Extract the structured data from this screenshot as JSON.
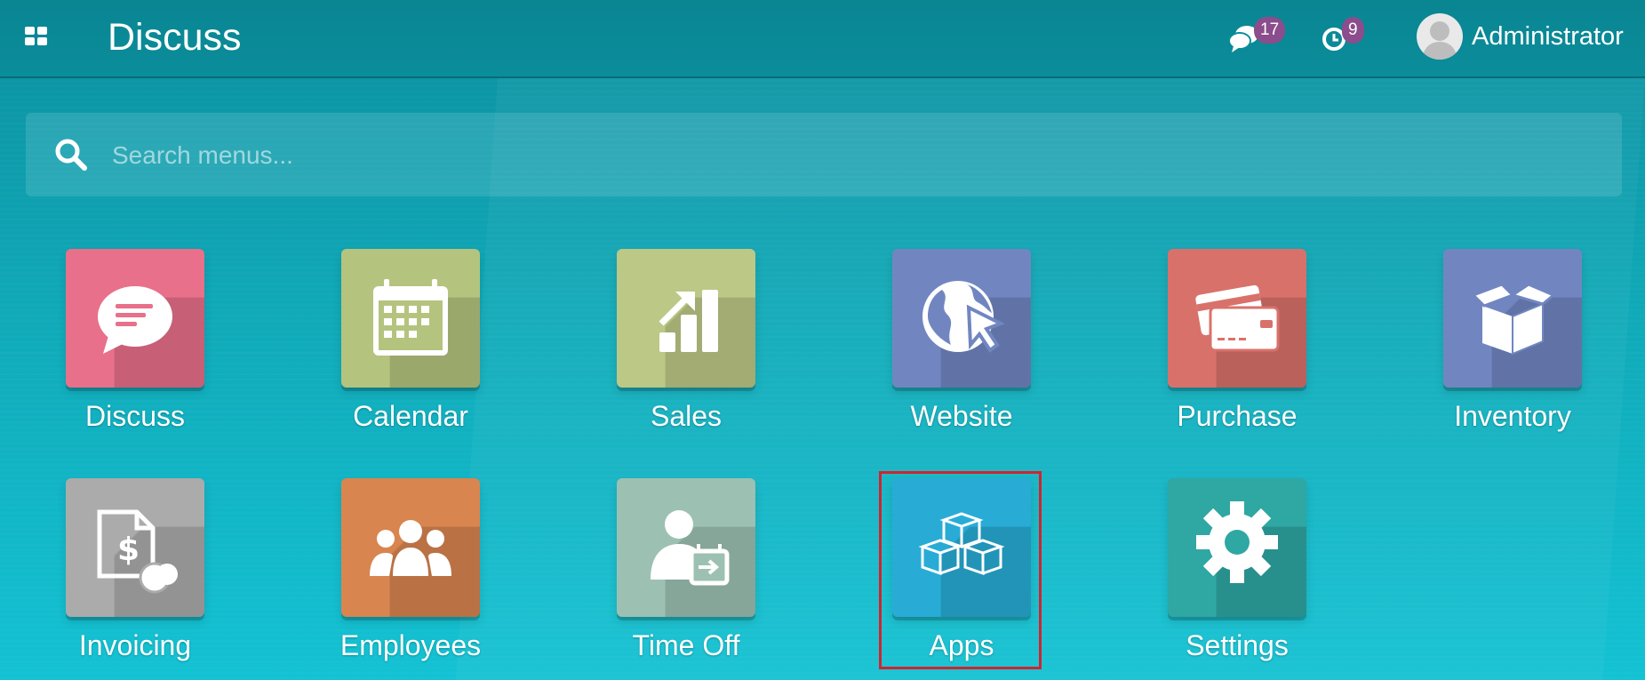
{
  "navbar": {
    "brand": "Discuss",
    "messages_count": "17",
    "activities_count": "9",
    "user_name": "Administrator"
  },
  "search": {
    "placeholder": "Search menus..."
  },
  "apps": [
    {
      "label": "Discuss",
      "icon": "chat-bubble-icon",
      "color": "#e8708a"
    },
    {
      "label": "Calendar",
      "icon": "calendar-icon",
      "color": "#b4c47e"
    },
    {
      "label": "Sales",
      "icon": "sales-chart-icon",
      "color": "#bcc886"
    },
    {
      "label": "Website",
      "icon": "globe-cursor-icon",
      "color": "#7186c1"
    },
    {
      "label": "Purchase",
      "icon": "credit-card-icon",
      "color": "#d9716b"
    },
    {
      "label": "Inventory",
      "icon": "open-box-icon",
      "color": "#7186c1"
    },
    {
      "label": "Invoicing",
      "icon": "invoice-dollar-icon",
      "color": "#ababab"
    },
    {
      "label": "Employees",
      "icon": "people-group-icon",
      "color": "#d88550"
    },
    {
      "label": "Time Off",
      "icon": "person-calendar-icon",
      "color": "#9cc1b2"
    },
    {
      "label": "Apps",
      "icon": "cubes-icon",
      "color": "#28acd6"
    },
    {
      "label": "Settings",
      "icon": "gear-icon",
      "color": "#2fa7a3"
    }
  ],
  "colors": {
    "badge": "#8b4d8c",
    "highlight": "#d1242f",
    "navbar": "#0b8d9b"
  }
}
